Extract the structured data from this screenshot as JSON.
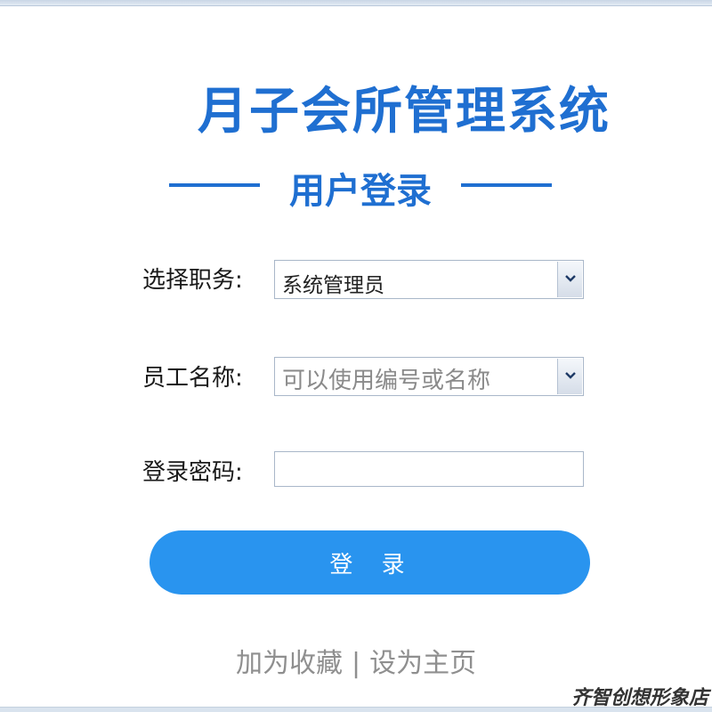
{
  "header": {
    "app_title": "月子会所管理系统",
    "subtitle": "用户登录"
  },
  "form": {
    "role_label": "选择职务:",
    "role_value": "系统管理员",
    "employee_label": "员工名称:",
    "employee_placeholder": "可以使用编号或名称",
    "password_label": "登录密码:",
    "password_value": ""
  },
  "login_button": "登 录",
  "links": {
    "bookmark": "加为收藏",
    "separator": "|",
    "homepage": "设为主页"
  },
  "watermark": "齐智创想形象店",
  "colors": {
    "accent": "#1f6fd1",
    "button": "#2994ef",
    "link": "#8f8f8f"
  }
}
